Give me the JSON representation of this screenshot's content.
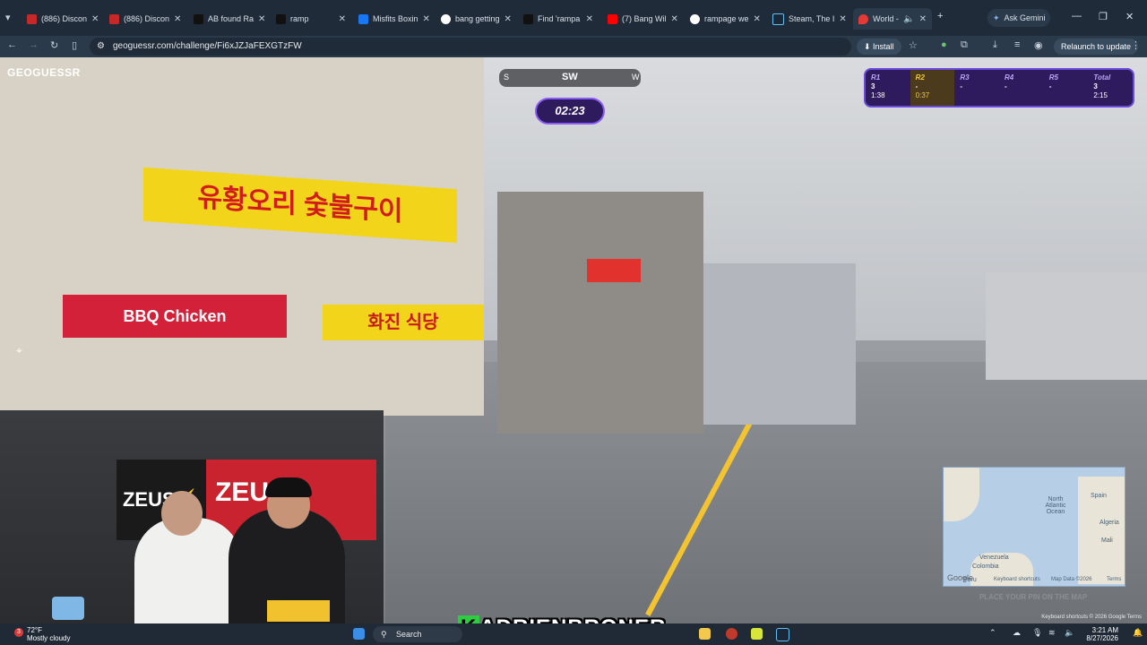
{
  "tabs": [
    {
      "title": "(886) Discon"
    },
    {
      "title": "(886) Discon"
    },
    {
      "title": "AB found Ra"
    },
    {
      "title": "ramp"
    },
    {
      "title": "Misfits Boxin"
    },
    {
      "title": "bang getting"
    },
    {
      "title": "Find 'rampa"
    },
    {
      "title": "(7) Bang Wil"
    },
    {
      "title": "rampage we"
    },
    {
      "title": "Steam, The I"
    },
    {
      "title": "World -"
    }
  ],
  "ask_gemini": "Ask Gemini",
  "url": "geoguessr.com/challenge/Fi6xJZJaFEXGTzFW",
  "install_label": "Install",
  "relaunch_label": "Relaunch to update",
  "game": {
    "logo": "GEOGUESSR",
    "compass": {
      "left": "S",
      "center": "SW",
      "right": "W"
    },
    "timer": "02:23",
    "rounds": [
      {
        "label": "R1",
        "points": "3",
        "time": "1:38"
      },
      {
        "label": "R2",
        "points": "-",
        "time": "0:37"
      },
      {
        "label": "R3",
        "points": "-",
        "time": ""
      },
      {
        "label": "R4",
        "points": "-",
        "time": ""
      },
      {
        "label": "R5",
        "points": "-",
        "time": ""
      },
      {
        "label": "Total",
        "points": "3",
        "time": "2:15"
      }
    ],
    "map_labels": {
      "north_atlantic": "North Atlantic Ocean",
      "spain": "Spain",
      "algeria": "Algeria",
      "mali": "Mali",
      "venezuela": "Venezuela",
      "colombia": "Colombia",
      "peru": "Peru"
    },
    "map_footer": {
      "google": "Google",
      "shortcuts": "Keyboard shortcuts",
      "mapdata": "Map Data ©2026",
      "terms": "Terms"
    },
    "place_pin": "PLACE YOUR PIN ON THE MAP",
    "credits": "Keyboard shortcuts  © 2026 Google  Terms"
  },
  "signs": {
    "sign_yellow": "유황오리 숯불구이",
    "sign_bbq": "BBQ Chicken",
    "sign_yellow2": "화진 식당"
  },
  "stream": {
    "nametag_k": "K",
    "nametag_rest": "ADRIENBRONER"
  },
  "taskbar": {
    "temp": "72°F",
    "weather": "Mostly cloudy",
    "badge": "3",
    "search": "Search",
    "time": "3:21 AM",
    "date": "8/27/2026"
  },
  "colors": {
    "chrome_bg": "#1f2b38",
    "accent_purple": "#6a4bdc",
    "timer_bg": "#2d1b5e",
    "active_round": "#f5c842"
  }
}
